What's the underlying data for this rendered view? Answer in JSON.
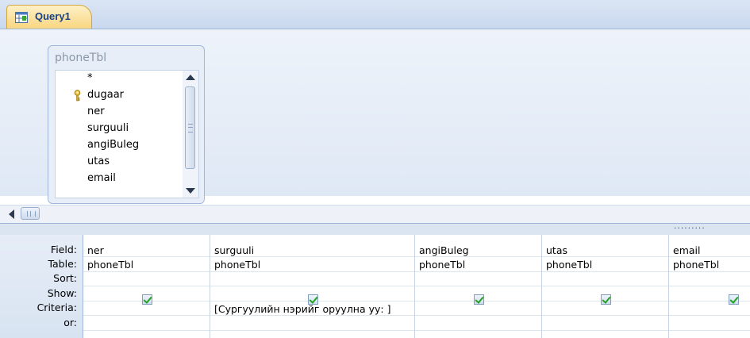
{
  "tab": {
    "title": "Query1"
  },
  "table_window": {
    "title": "phoneTbl",
    "fields": [
      "*",
      "dugaar",
      "ner",
      "surguuli",
      "angiBuleg",
      "utas",
      "email"
    ],
    "key_field": "dugaar"
  },
  "grid": {
    "row_labels": [
      "Field:",
      "Table:",
      "Sort:",
      "Show:",
      "Criteria:",
      "or:"
    ],
    "columns": [
      {
        "field": "ner",
        "table": "phoneTbl",
        "sort": "",
        "show": true,
        "criteria": "",
        "or": ""
      },
      {
        "field": "surguuli",
        "table": "phoneTbl",
        "sort": "",
        "show": true,
        "criteria": "[Сургуулийн нэрийг оруулна уу: ]",
        "or": ""
      },
      {
        "field": "angiBuleg",
        "table": "phoneTbl",
        "sort": "",
        "show": true,
        "criteria": "",
        "or": ""
      },
      {
        "field": "utas",
        "table": "phoneTbl",
        "sort": "",
        "show": true,
        "criteria": "",
        "or": ""
      },
      {
        "field": "email",
        "table": "phoneTbl",
        "sort": "",
        "show": true,
        "criteria": "",
        "or": ""
      }
    ]
  },
  "colors": {
    "tab_active": "#f9d680",
    "panel_bg": "#dfe8f5",
    "checkmark": "#21a121"
  },
  "icons": [
    "query-icon",
    "primary-key-icon",
    "scroll-up-icon",
    "scroll-down-icon",
    "scroll-left-icon"
  ]
}
